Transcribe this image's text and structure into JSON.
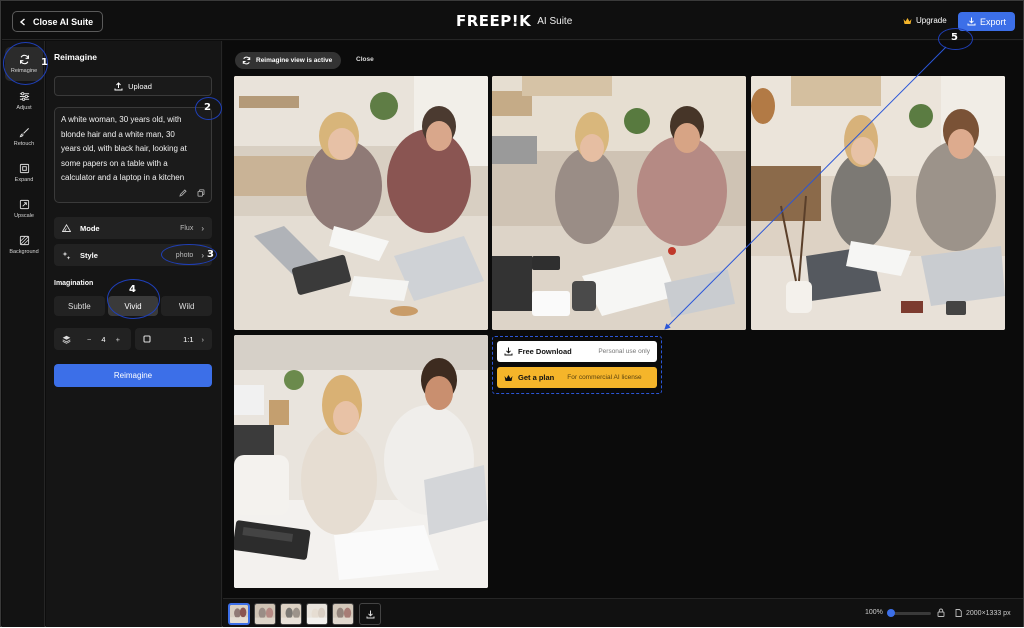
{
  "topbar": {
    "close_label": "Close AI Suite",
    "brand_logo": "FREEP!K",
    "brand_sub": "AI Suite",
    "upgrade_label": "Upgrade",
    "export_label": "Export"
  },
  "rail": {
    "items": [
      {
        "label": "Reimagine",
        "icon": "refresh-icon"
      },
      {
        "label": "Adjust",
        "icon": "sliders-icon"
      },
      {
        "label": "Retouch",
        "icon": "brush-icon"
      },
      {
        "label": "Expand",
        "icon": "expand-icon"
      },
      {
        "label": "Upscale",
        "icon": "upscale-icon"
      },
      {
        "label": "Background",
        "icon": "background-icon"
      }
    ]
  },
  "panel": {
    "title": "Reimagine",
    "upload_label": "Upload",
    "prompt_lines": [
      "A  white woman,  30 years old, with",
      "blonde hair and a  white man,  30",
      "years old, with  black hair, looking at",
      "some papers on a table with a",
      "calculator and a laptop in a  kitchen"
    ],
    "mode_label": "Mode",
    "mode_value": "Flux",
    "style_label": "Style",
    "style_value": "photo",
    "imagination_label": "Imagination",
    "imagination_options": [
      "Subtle",
      "Vivid",
      "Wild"
    ],
    "imagination_selected": "Vivid",
    "count_value": "4",
    "count_minus": "−",
    "count_plus": "+",
    "ratio_value": "1:1",
    "reimagine_button": "Reimagine"
  },
  "main": {
    "active_chip": "Reimagine view is active",
    "close_label": "Close",
    "free_download_label": "Free Download",
    "free_download_sub": "Personal use only",
    "get_plan_label": "Get a plan",
    "get_plan_sub": "For commercial AI license"
  },
  "bottombar": {
    "zoom_label": "100%",
    "zoom_level": 0.0,
    "dimensions": "2000×1333 px"
  },
  "annotations": [
    "1",
    "2",
    "3",
    "4",
    "5"
  ],
  "colors": {
    "accent": "#3c6fe8",
    "plan": "#f5b52a",
    "annotation": "#1f3fb8"
  }
}
